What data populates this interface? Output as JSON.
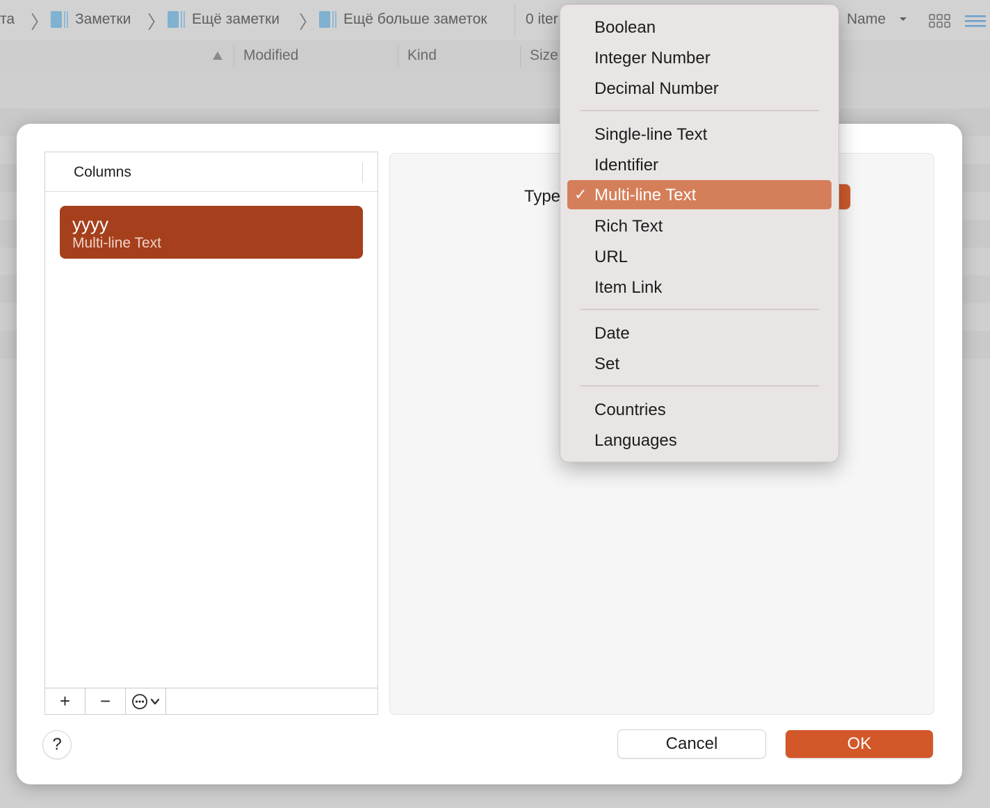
{
  "background": {
    "breadcrumbs": [
      "та",
      "Заметки",
      "Ещё заметки",
      "Ещё больше заметок"
    ],
    "item_count": "0 iter",
    "sort_label": "Name",
    "columns": [
      "Modified",
      "Kind",
      "Size"
    ]
  },
  "dialog": {
    "columns_header": "Columns",
    "column_item": {
      "name": "yyyy",
      "type": "Multi-line Text"
    },
    "toolbar": {
      "add": "+",
      "remove": "−",
      "more": "⋯"
    },
    "type_label": "Type",
    "help": "?",
    "cancel": "Cancel",
    "ok": "OK"
  },
  "menu": {
    "groups": [
      [
        "Boolean",
        "Integer Number",
        "Decimal Number"
      ],
      [
        "Single-line Text",
        "Identifier",
        "Multi-line Text",
        "Rich Text",
        "URL",
        "Item Link"
      ],
      [
        "Date",
        "Set"
      ],
      [
        "Countries",
        "Languages"
      ]
    ],
    "selected": "Multi-line Text",
    "check_mark": "✓"
  },
  "colors": {
    "accent": "#d2582a",
    "selection": "#a53f1c",
    "menu_highlight": "#d57f5a"
  }
}
